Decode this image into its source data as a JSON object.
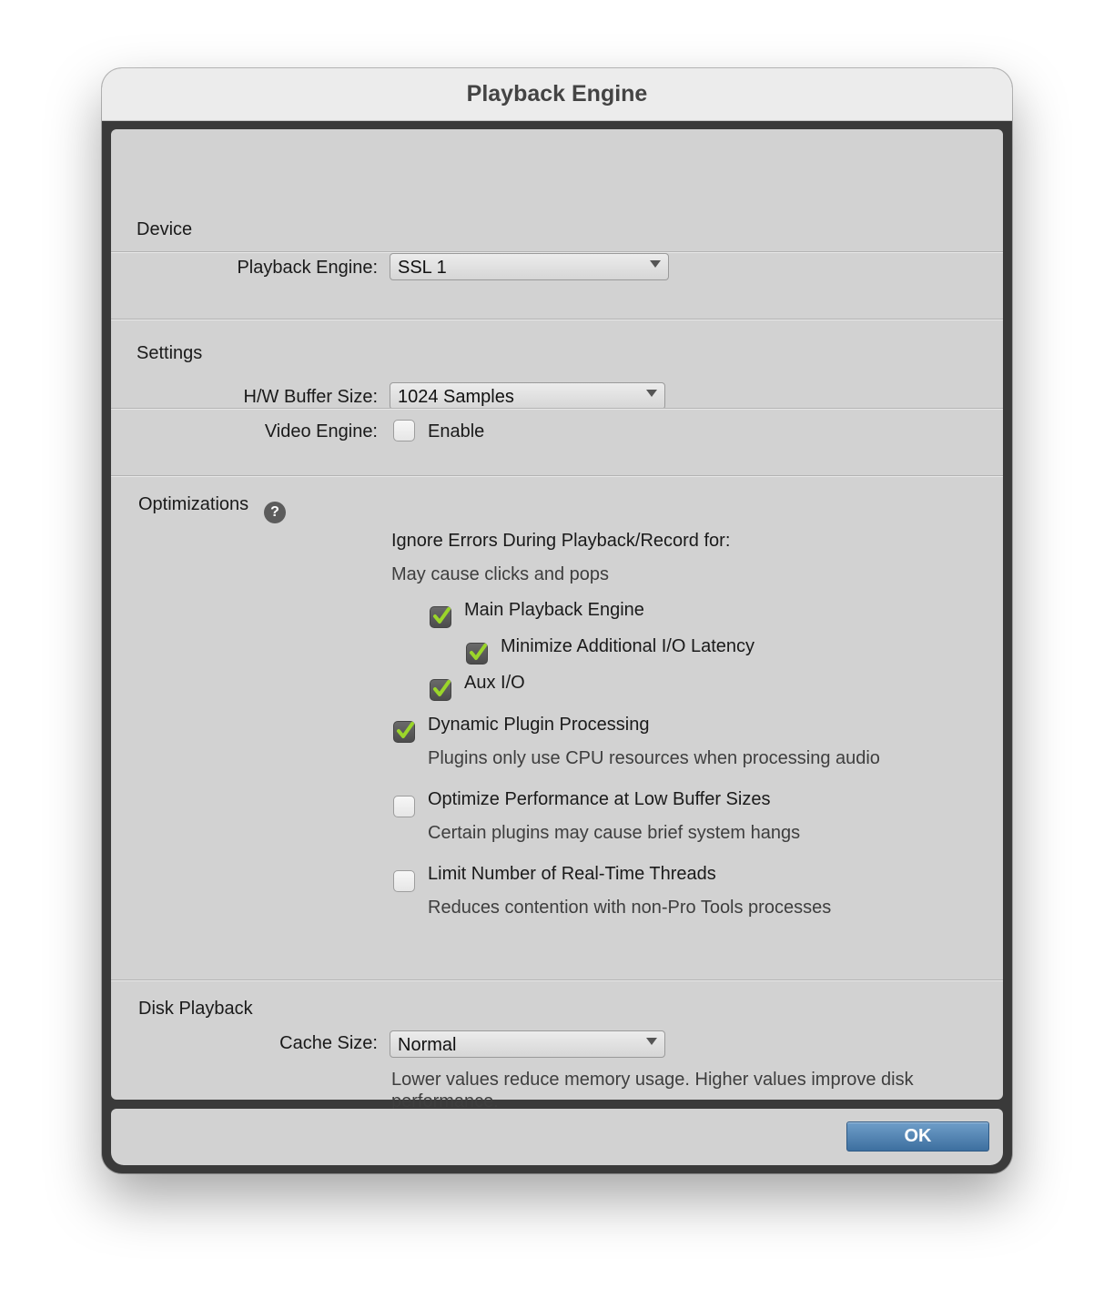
{
  "window": {
    "title": "Playback Engine"
  },
  "device": {
    "section_title": "Device",
    "playback_engine_label": "Playback Engine:",
    "playback_engine_value": "SSL 1"
  },
  "settings": {
    "section_title": "Settings",
    "buffer_label": "H/W Buffer Size:",
    "buffer_value": "1024 Samples",
    "video_label": "Video Engine:",
    "video_enable_label": "Enable",
    "video_enabled": false
  },
  "optimizations": {
    "section_title": "Optimizations",
    "help_icon_glyph": "?",
    "ignore_errors_heading": "Ignore Errors During Playback/Record for:",
    "ignore_errors_note": "May cause clicks and pops",
    "main_playback_engine": {
      "label": "Main Playback Engine",
      "checked": true
    },
    "minimize_io_latency": {
      "label": "Minimize Additional I/O Latency",
      "checked": true
    },
    "aux_io": {
      "label": "Aux I/O",
      "checked": true
    },
    "dynamic_plugin": {
      "label": "Dynamic Plugin Processing",
      "note": "Plugins only use CPU resources when processing audio",
      "checked": true
    },
    "optimize_low_buffer": {
      "label": "Optimize Performance at Low Buffer Sizes",
      "note": "Certain plugins may cause brief system hangs",
      "checked": false
    },
    "limit_threads": {
      "label": "Limit Number of Real-Time Threads",
      "note": "Reduces contention with non-Pro Tools processes",
      "checked": false
    }
  },
  "disk": {
    "section_title": "Disk Playback",
    "cache_label": "Cache Size:",
    "cache_value": "Normal",
    "note_line1": "Lower values reduce memory usage. Higher values improve disk",
    "note_line2": "performance."
  },
  "footer": {
    "ok_label": "OK"
  },
  "colors": {
    "check_green": "#9bd62a",
    "ok_blue": "#4f81b1"
  }
}
